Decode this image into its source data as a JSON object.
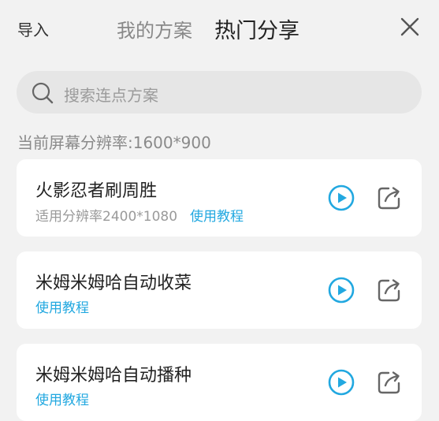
{
  "header": {
    "import_label": "导入",
    "tabs": [
      {
        "label": "我的方案",
        "active": false
      },
      {
        "label": "热门分享",
        "active": true
      }
    ]
  },
  "search": {
    "placeholder": "搜索连点方案"
  },
  "resolution_text": "当前屏幕分辨率:1600*900",
  "colors": {
    "accent": "#22a8e0",
    "background": "#f2f2f2",
    "card": "#ffffff"
  },
  "icons": {
    "search": "search-icon",
    "close": "close-icon",
    "play": "play-icon",
    "share": "share-icon"
  },
  "schemes": [
    {
      "title": "火影忍者刷周胜",
      "resolution": "适用分辨率2400*1080",
      "tutorial": "使用教程"
    },
    {
      "title": "米姆米姆哈自动收菜",
      "resolution": "",
      "tutorial": "使用教程"
    },
    {
      "title": "米姆米姆哈自动播种",
      "resolution": "",
      "tutorial": "使用教程"
    }
  ]
}
